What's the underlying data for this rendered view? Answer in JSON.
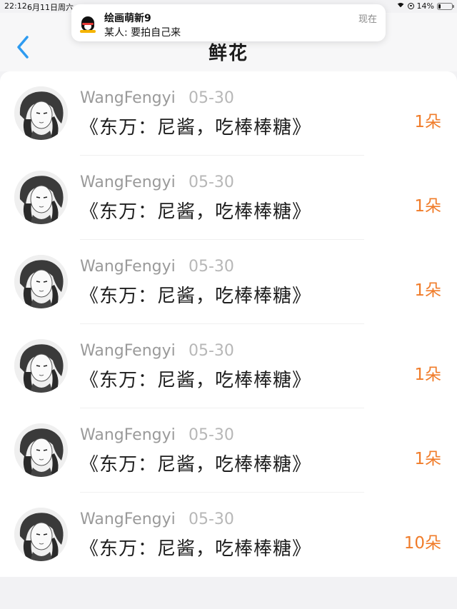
{
  "status_bar": {
    "time": "22:12",
    "date": "6月11日周六",
    "battery": "14%",
    "battery_level": 0.14
  },
  "header": {
    "title": "鲜花"
  },
  "notification": {
    "app_icon": "qq-penguin-icon",
    "title": "绘画萌新9",
    "message": "某人: 要拍自己来",
    "time": "现在"
  },
  "list": {
    "items": [
      {
        "username": "WangFengyi",
        "date": "05-30",
        "gift_title": "《东万：尼酱，吃棒棒糖》",
        "flower_count": "1朵"
      },
      {
        "username": "WangFengyi",
        "date": "05-30",
        "gift_title": "《东万：尼酱，吃棒棒糖》",
        "flower_count": "1朵"
      },
      {
        "username": "WangFengyi",
        "date": "05-30",
        "gift_title": "《东万：尼酱，吃棒棒糖》",
        "flower_count": "1朵"
      },
      {
        "username": "WangFengyi",
        "date": "05-30",
        "gift_title": "《东万：尼酱，吃棒棒糖》",
        "flower_count": "1朵"
      },
      {
        "username": "WangFengyi",
        "date": "05-30",
        "gift_title": "《东万：尼酱，吃棒棒糖》",
        "flower_count": "1朵"
      },
      {
        "username": "WangFengyi",
        "date": "05-30",
        "gift_title": "《东万：尼酱，吃棒棒糖》",
        "flower_count": "10朵"
      }
    ]
  },
  "colors": {
    "accent": "#2e9bf0",
    "flower_count": "#f07c2a",
    "username": "#9a9a9a",
    "date": "#b7b7b7"
  }
}
